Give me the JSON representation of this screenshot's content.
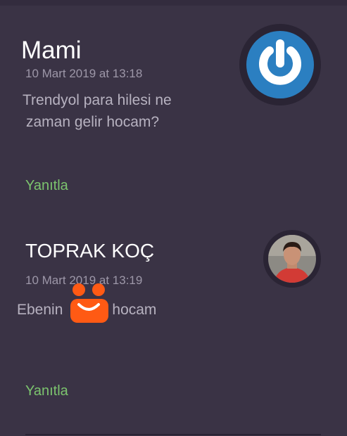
{
  "comments": [
    {
      "author": "Mami",
      "date": "10 Mart 2019 at 13:18",
      "text_line1": "Trendyol para hilesi ne",
      "text_line2": "zaman gelir hocam?",
      "reply_label": "Yanıtla",
      "avatar": "power-logo-icon"
    },
    {
      "author": "TOPRAK KOÇ",
      "date": "10 Mart 2019 at 13:19",
      "text_before": "Ebenin",
      "text_after": "hocam",
      "reply_label": "Yanıtla",
      "avatar": "user-photo"
    }
  ],
  "colors": {
    "background": "#3a3345",
    "reply": "#7cc46e",
    "logo_blue": "#2b7fc1",
    "sticker_orange": "#ff5a14"
  }
}
